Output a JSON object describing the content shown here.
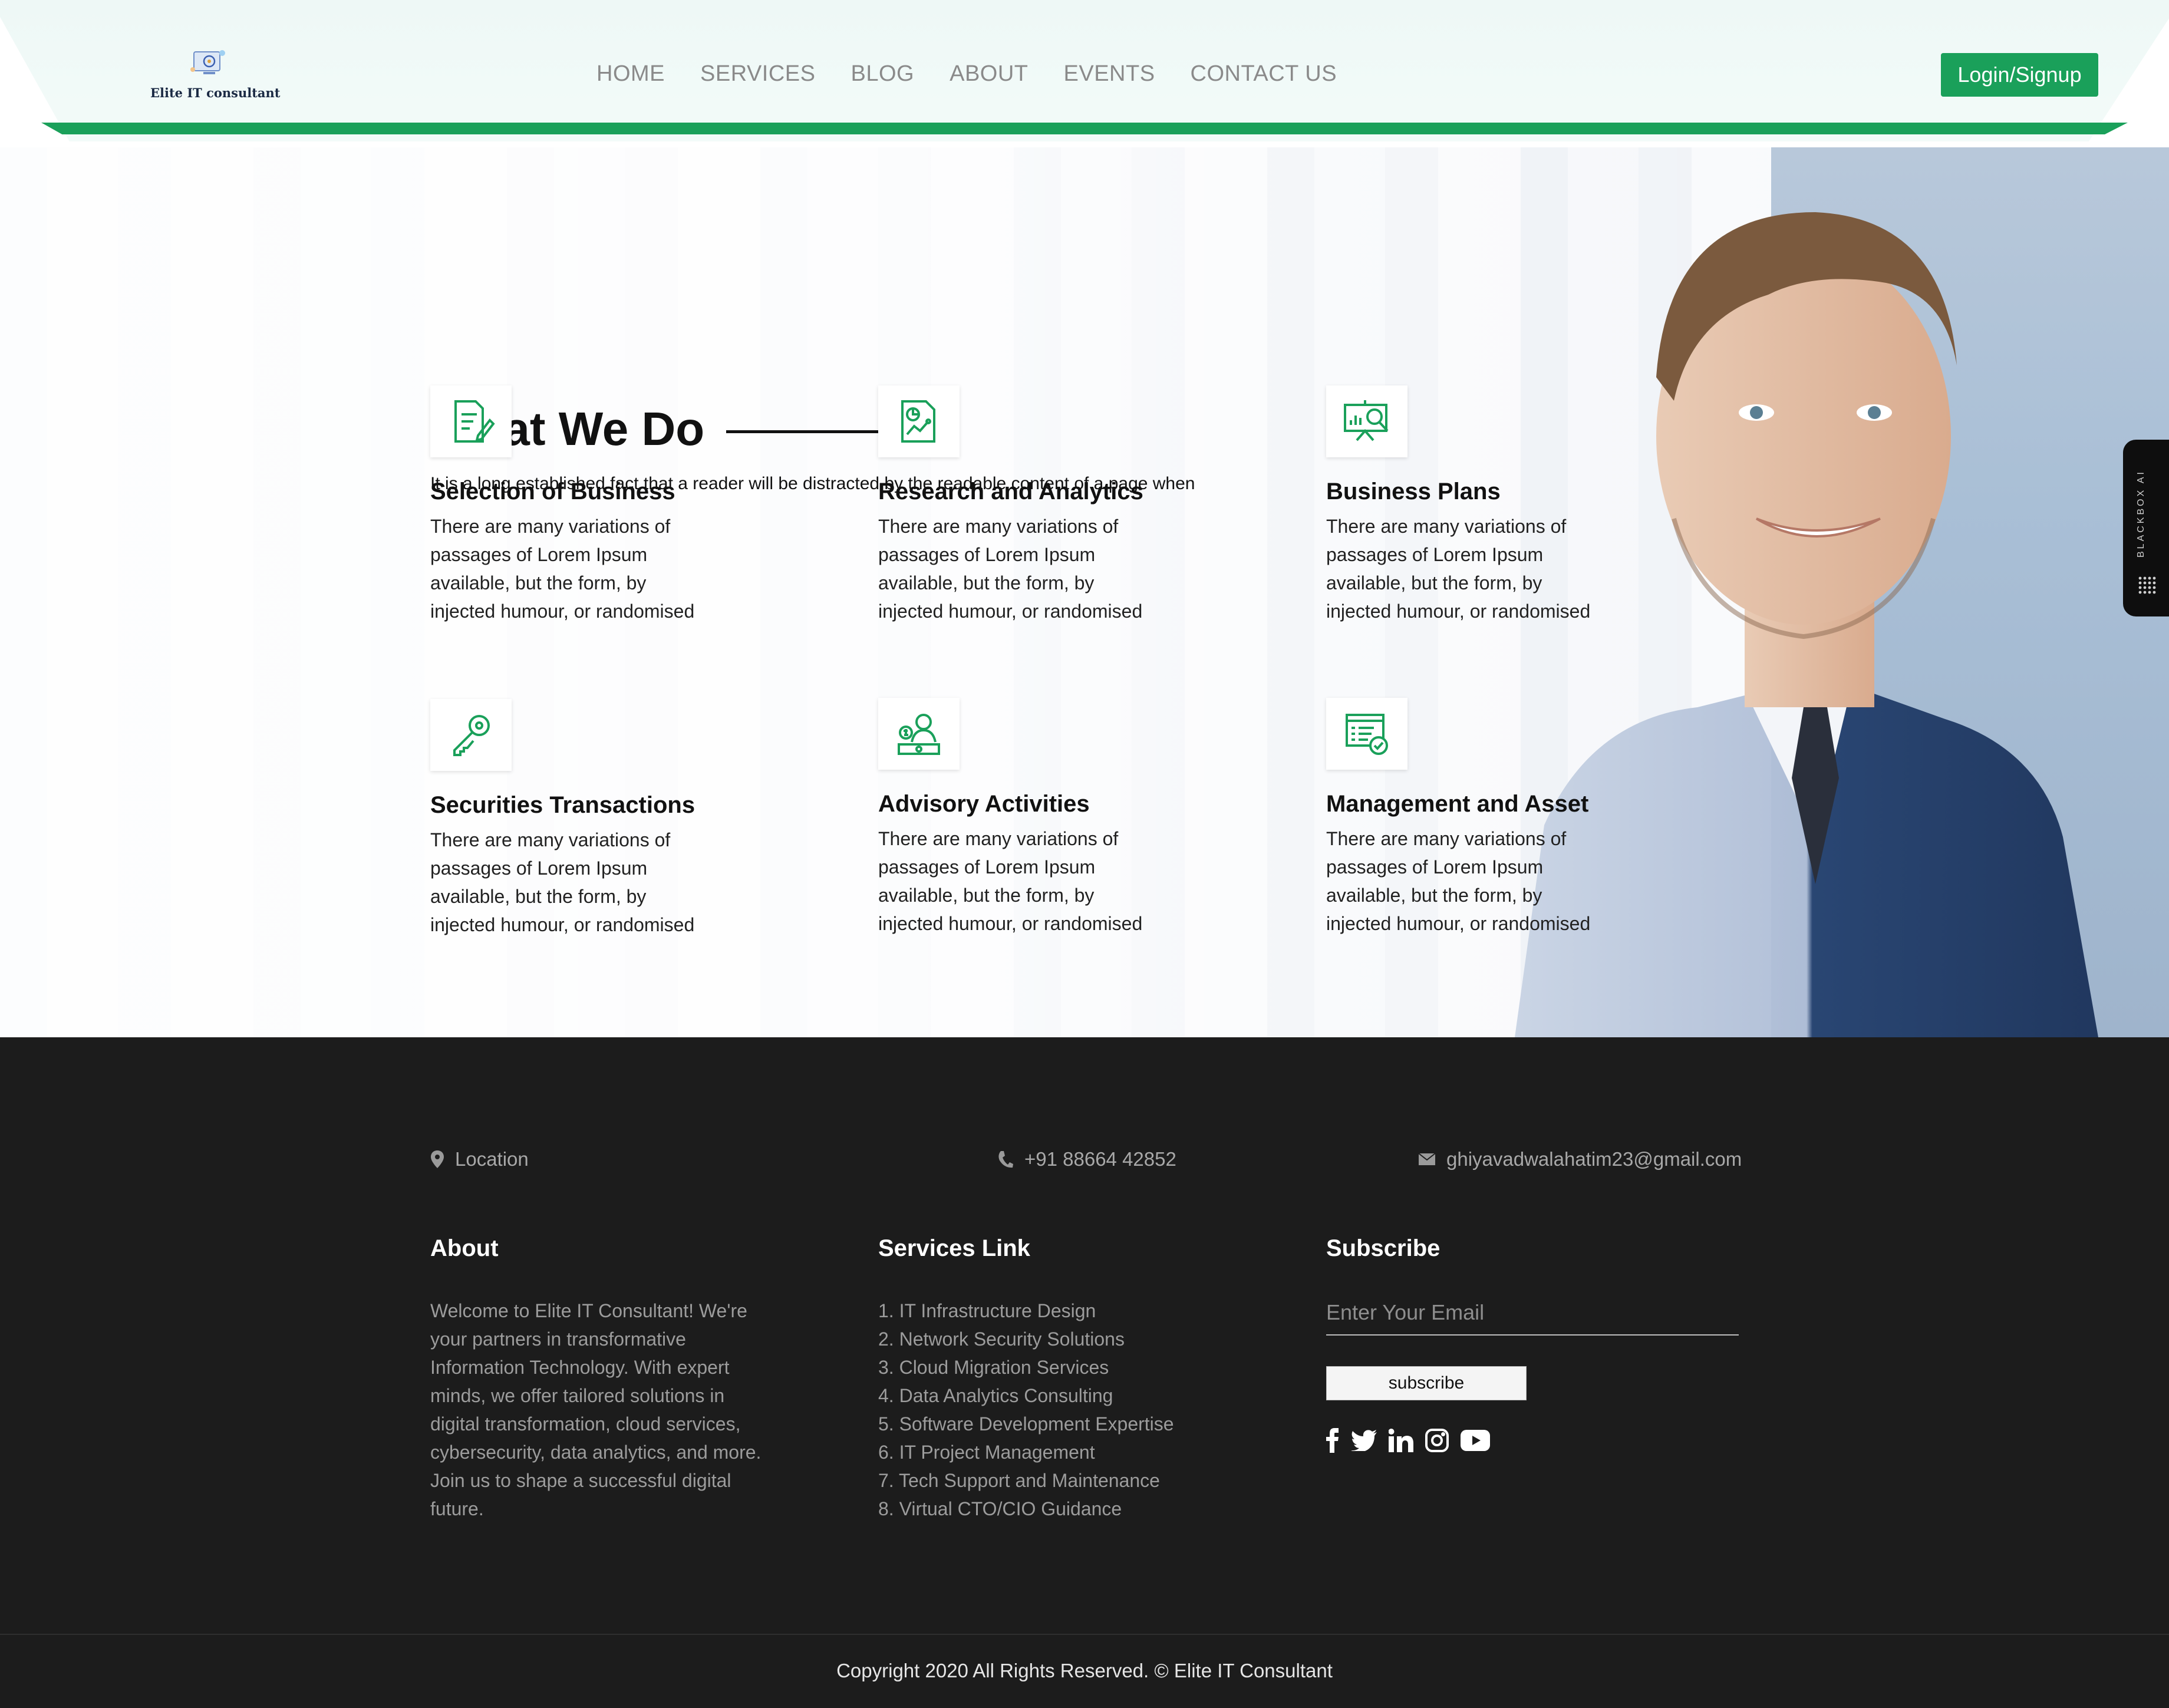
{
  "brand": {
    "name": "Elite IT consultant",
    "accent": "#1aa05a"
  },
  "nav": {
    "items": [
      "HOME",
      "SERVICES",
      "BLOG",
      "ABOUT",
      "EVENTS",
      "CONTACT US"
    ]
  },
  "header": {
    "login_label": "Login/Signup"
  },
  "hero": {
    "title": "What We Do",
    "subtitle": "It is a long established fact that a reader will be distracted by the readable content of a page when",
    "cards": [
      {
        "icon": "document-edit-icon",
        "title": "Selection of Business",
        "text": "There are many variations of passages of Lorem Ipsum available, but the form, by injected humour, or randomised"
      },
      {
        "icon": "report-chart-icon",
        "title": "Research and Analytics",
        "text": "There are many variations of passages of Lorem Ipsum available, but the form, by injected humour, or randomised"
      },
      {
        "icon": "presentation-search-icon",
        "title": "Business Plans",
        "text": "There are many variations of passages of Lorem Ipsum available, but the form, by injected humour, or randomised"
      },
      {
        "icon": "key-icon",
        "title": "Securities Transactions",
        "text": "There are many variations of passages of Lorem Ipsum available, but the form, by injected humour, or randomised"
      },
      {
        "icon": "advisor-icon",
        "title": "Advisory Activities",
        "text": "There are many variations of passages of Lorem Ipsum available, but the form, by injected humour, or randomised"
      },
      {
        "icon": "checklist-icon",
        "title": "Management and Asset",
        "text": "There are many variations of passages of Lorem Ipsum available, but the form, by injected humour, or randomised"
      }
    ]
  },
  "widget": {
    "label": "BLACKBOX AI"
  },
  "footer": {
    "contact": {
      "location": "Location",
      "phone": "+91 88664 42852",
      "email": "ghiyavadwalahatim23@gmail.com"
    },
    "about": {
      "title": "About",
      "text": "Welcome to Elite IT Consultant! We're your partners in transformative Information Technology. With expert minds, we offer tailored solutions in digital transformation, cloud services, cybersecurity, data analytics, and more. Join us to shape a successful digital future."
    },
    "services": {
      "title": "Services Link",
      "items": [
        "1. IT Infrastructure Design",
        "2. Network Security Solutions",
        "3. Cloud Migration Services",
        "4. Data Analytics Consulting",
        "5. Software Development Expertise",
        "6. IT Project Management",
        "7. Tech Support and Maintenance",
        "8. Virtual CTO/CIO Guidance"
      ]
    },
    "subscribe": {
      "title": "Subscribe",
      "placeholder": "Enter Your Email",
      "button": "subscribe",
      "socials": [
        "facebook-icon",
        "twitter-icon",
        "linkedin-icon",
        "instagram-icon",
        "youtube-icon"
      ]
    },
    "copyright": "Copyright 2020 All Rights Reserved. © Elite IT Consultant"
  }
}
